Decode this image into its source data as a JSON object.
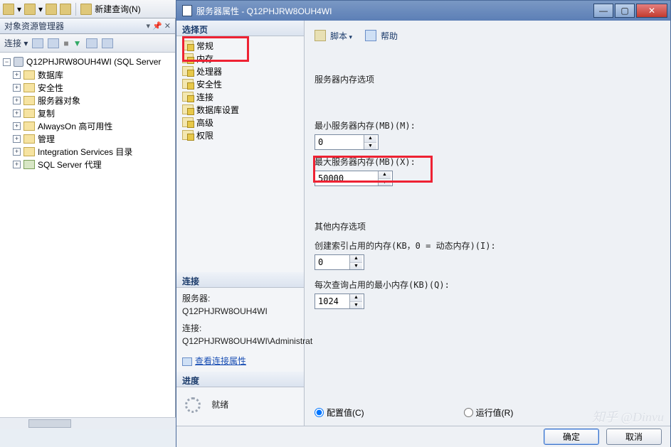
{
  "bg_toolbar": {
    "new_query": "新建查询(N)"
  },
  "object_explorer": {
    "title": "对象资源管理器",
    "pin_close": "▾ 📌 ✕",
    "connect_label": "连接 ▾",
    "server": "Q12PHJRW8OUH4WI (SQL Server",
    "nodes": [
      "数据库",
      "安全性",
      "服务器对象",
      "复制",
      "AlwaysOn 高可用性",
      "管理",
      "Integration Services 目录",
      "SQL Server 代理"
    ]
  },
  "dialog": {
    "title": "服务器属性 - Q12PHJRW8OUH4WI",
    "select_page": "选择页",
    "pages": [
      "常规",
      "内存",
      "处理器",
      "安全性",
      "连接",
      "数据库设置",
      "高级",
      "权限"
    ],
    "connection_head": "连接",
    "conn_server_label": "服务器:",
    "conn_server_value": "Q12PHJRW8OUH4WI",
    "conn_conn_label": "连接:",
    "conn_conn_value": "Q12PHJRW8OUH4WI\\Administrat",
    "view_props": "查看连接属性",
    "progress_head": "进度",
    "progress_status": "就绪",
    "right": {
      "script": "脚本",
      "help": "帮助",
      "section1": "服务器内存选项",
      "min_label": "最小服务器内存(MB)(M):",
      "min_value": "0",
      "max_label": "最大服务器内存(MB)(X):",
      "max_value": "50000",
      "section2": "其他内存选项",
      "index_label": "创建索引占用的内存(KB，0 = 动态内存)(I):",
      "index_value": "0",
      "query_label": "每次查询占用的最小内存(KB)(Q):",
      "query_value": "1024",
      "radio_cfg": "配置值(C)",
      "radio_run": "运行值(R)"
    },
    "ok": "确定",
    "cancel": "取消"
  },
  "watermark": "知乎 @Dinvu"
}
